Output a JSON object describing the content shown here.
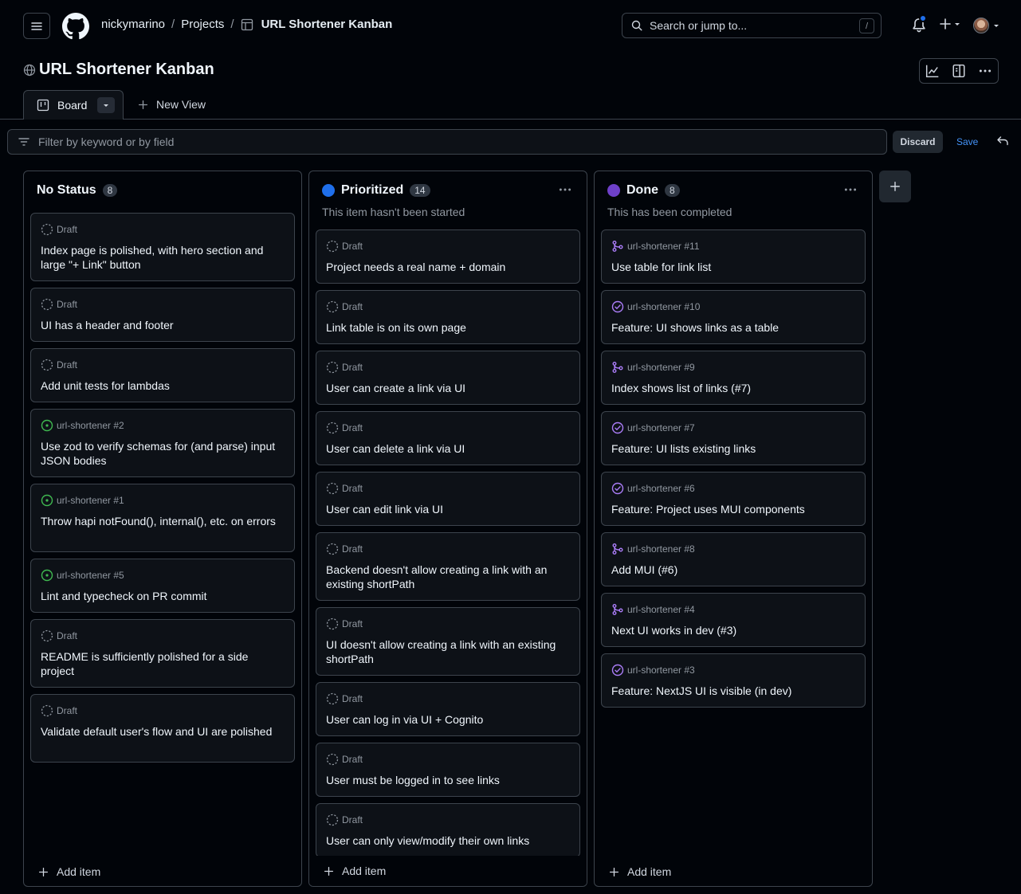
{
  "nav": {
    "owner": "nickymarino",
    "projects": "Projects",
    "project": "URL Shortener Kanban",
    "search_placeholder": "Search or jump to...",
    "search_shortcut": "/"
  },
  "project": {
    "title": "URL Shortener Kanban",
    "tabs": {
      "board": "Board",
      "new_view": "New View"
    }
  },
  "filter": {
    "placeholder": "Filter by keyword or by field",
    "discard": "Discard",
    "save": "Save"
  },
  "colors": {
    "prioritized": "#1f6feb",
    "done": "#6e40c9",
    "open_issue": "#3fb950",
    "closed_issue": "#ab7df8",
    "merged_pr": "#ab7df8"
  },
  "columns": [
    {
      "name": "No Status",
      "count": "8",
      "description": "",
      "add_item": "Add item",
      "cards": [
        {
          "type": "draft",
          "meta": "Draft",
          "title": "Index page is polished, with hero section and large \"+ Link\" button"
        },
        {
          "type": "draft",
          "meta": "Draft",
          "title": "UI has a header and footer"
        },
        {
          "type": "draft",
          "meta": "Draft",
          "title": "Add unit tests for lambdas"
        },
        {
          "type": "open",
          "meta": "url-shortener #2",
          "title": "Use zod to verify schemas for (and parse) input JSON bodies"
        },
        {
          "type": "open",
          "meta": "url-shortener #1",
          "title": "Throw hapi notFound(), internal(), etc. on errors"
        },
        {
          "type": "open",
          "meta": "url-shortener #5",
          "title": "Lint and typecheck on PR commit"
        },
        {
          "type": "draft",
          "meta": "Draft",
          "title": "README is sufficiently polished for a side project"
        },
        {
          "type": "draft",
          "meta": "Draft",
          "title": "Validate default user's flow and UI are polished"
        }
      ]
    },
    {
      "name": "Prioritized",
      "count": "14",
      "description": "This item hasn't been started",
      "add_item": "Add item",
      "cards": [
        {
          "type": "draft",
          "meta": "Draft",
          "title": "Project needs a real name + domain"
        },
        {
          "type": "draft",
          "meta": "Draft",
          "title": "Link table is on its own page"
        },
        {
          "type": "draft",
          "meta": "Draft",
          "title": "User can create a link via UI"
        },
        {
          "type": "draft",
          "meta": "Draft",
          "title": "User can delete a link via UI"
        },
        {
          "type": "draft",
          "meta": "Draft",
          "title": "User can edit link via UI"
        },
        {
          "type": "draft",
          "meta": "Draft",
          "title": "Backend doesn't allow creating a link with an existing shortPath"
        },
        {
          "type": "draft",
          "meta": "Draft",
          "title": "UI doesn't allow creating a link with an existing shortPath"
        },
        {
          "type": "draft",
          "meta": "Draft",
          "title": "User can log in via UI + Cognito"
        },
        {
          "type": "draft",
          "meta": "Draft",
          "title": "User must be logged in to see links"
        },
        {
          "type": "draft",
          "meta": "Draft",
          "title": "User can only view/modify their own links"
        }
      ]
    },
    {
      "name": "Done",
      "count": "8",
      "description": "This has been completed",
      "add_item": "Add item",
      "cards": [
        {
          "type": "merged",
          "meta": "url-shortener #11",
          "title": "Use table for link list"
        },
        {
          "type": "closed",
          "meta": "url-shortener #10",
          "title": "Feature: UI shows links as a table"
        },
        {
          "type": "merged",
          "meta": "url-shortener #9",
          "title": "Index shows list of links (#7)"
        },
        {
          "type": "closed",
          "meta": "url-shortener #7",
          "title": "Feature: UI lists existing links"
        },
        {
          "type": "closed",
          "meta": "url-shortener #6",
          "title": "Feature: Project uses MUI components"
        },
        {
          "type": "merged",
          "meta": "url-shortener #8",
          "title": "Add MUI (#6)"
        },
        {
          "type": "merged",
          "meta": "url-shortener #4",
          "title": "Next UI works in dev (#3)"
        },
        {
          "type": "closed",
          "meta": "url-shortener #3",
          "title": "Feature: NextJS UI is visible (in dev)"
        }
      ]
    }
  ]
}
